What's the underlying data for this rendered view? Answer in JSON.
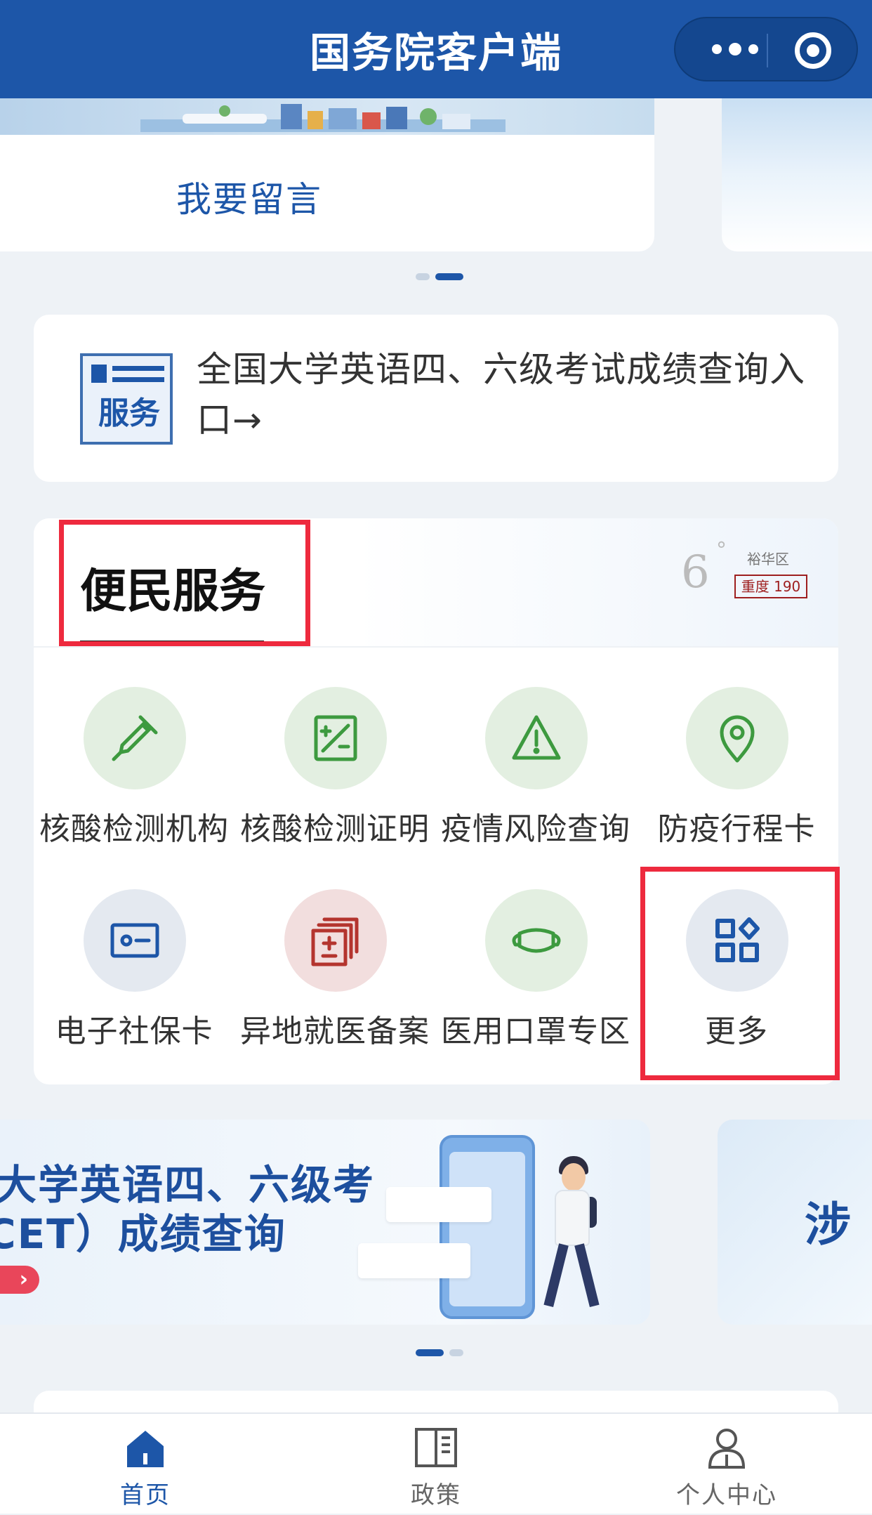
{
  "header": {
    "title": "国务院客户端"
  },
  "top_carousel": {
    "card_label": "我要留言"
  },
  "notice": {
    "icon_text": "服务",
    "text": "全国大学英语四、六级考试成绩查询入口→"
  },
  "services": {
    "title": "便民服务",
    "weather": {
      "temp": "6",
      "degree": "°",
      "region": "裕华区",
      "aqi": "重度 190"
    },
    "items": [
      {
        "label": "核酸检测机构",
        "icon": "dropper-icon"
      },
      {
        "label": "核酸检测证明",
        "icon": "certificate-icon"
      },
      {
        "label": "疫情风险查询",
        "icon": "warning-icon"
      },
      {
        "label": "防疫行程卡",
        "icon": "location-pin-icon"
      },
      {
        "label": "电子社保卡",
        "icon": "id-card-icon"
      },
      {
        "label": "异地就医备案",
        "icon": "medical-record-icon"
      },
      {
        "label": "医用口罩专区",
        "icon": "mask-icon"
      },
      {
        "label": "更多",
        "icon": "grid-more-icon"
      }
    ]
  },
  "banner": {
    "line1": "大学英语四、六级考",
    "line2": "CET）成绩查询",
    "arrow": "›",
    "next_text": "涉"
  },
  "tabbar": {
    "tabs": [
      {
        "label": "首页",
        "active": true
      },
      {
        "label": "政策",
        "active": false
      },
      {
        "label": "个人中心",
        "active": false
      }
    ]
  },
  "colors": {
    "primary": "#1d56a8",
    "highlight": "#ee2a3e",
    "green_icon": "#3d9a3f"
  }
}
